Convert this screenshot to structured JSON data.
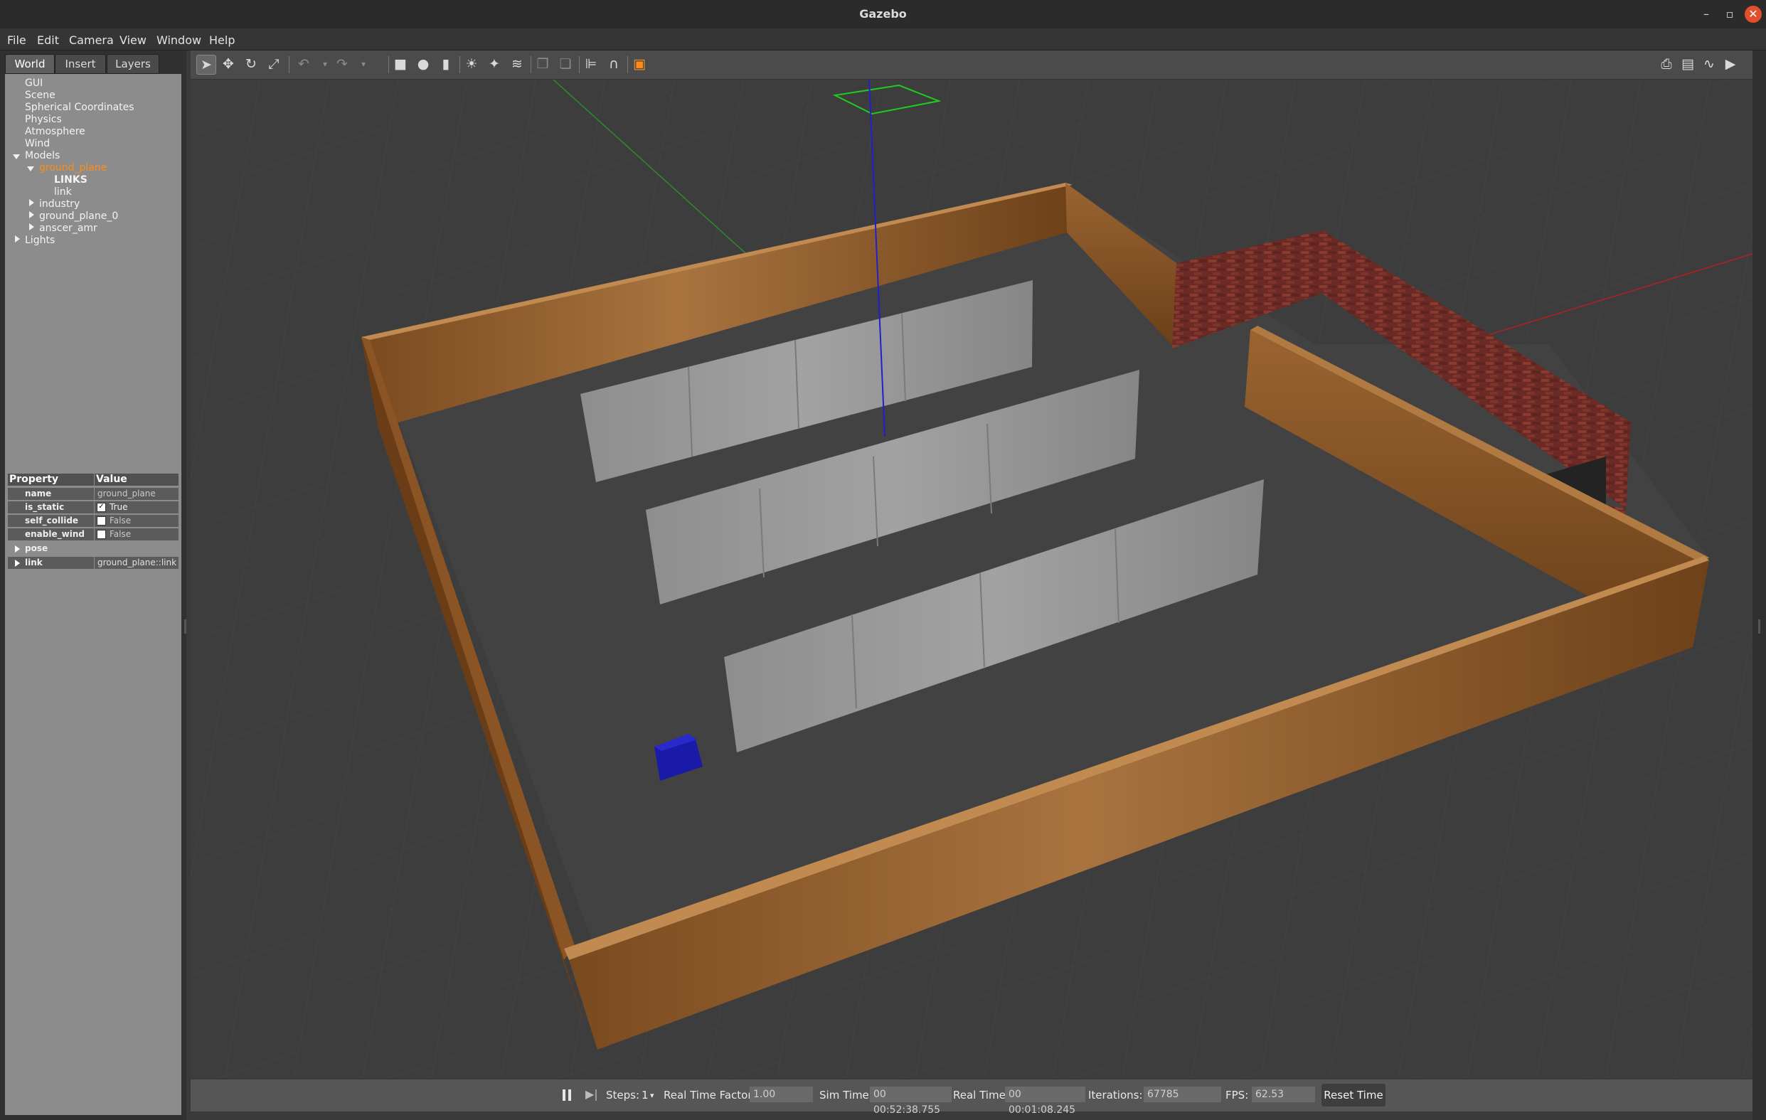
{
  "window": {
    "title": "Gazebo",
    "minimize": "–",
    "restore": "▫",
    "close": "✕"
  },
  "menu": [
    "File",
    "Edit",
    "Camera",
    "View",
    "Window",
    "Help"
  ],
  "tabs": [
    "World",
    "Insert",
    "Layers"
  ],
  "tree": {
    "gui": "GUI",
    "scene": "Scene",
    "spherical": "Spherical Coordinates",
    "physics": "Physics",
    "atmosphere": "Atmosphere",
    "wind": "Wind",
    "models": "Models",
    "ground_plane": "ground_plane",
    "links": "LINKS",
    "link": "link",
    "industry": "industry",
    "ground_plane_0": "ground_plane_0",
    "anscer_amr": "anscer_amr",
    "lights": "Lights"
  },
  "properties": {
    "header_property": "Property",
    "header_value": "Value",
    "name_label": "name",
    "name_value": "ground_plane",
    "is_static_label": "is_static",
    "is_static_value": "True",
    "is_static_check": "✓",
    "self_collide_label": "self_collide",
    "self_collide_value": "False",
    "enable_wind_label": "enable_wind",
    "enable_wind_value": "False",
    "pose_label": "pose",
    "link_label": "link",
    "link_value": "ground_plane::link"
  },
  "status": {
    "steps_label": "Steps:",
    "steps_value": "1",
    "rtf_label": "Real Time Factor:",
    "rtf_value": "1.00",
    "sim_time_label": "Sim Time:",
    "sim_time_value": "00 00:52:38.755",
    "real_time_label": "Real Time:",
    "real_time_value": "00 00:01:08.245",
    "iterations_label": "Iterations:",
    "iterations_value": "67785",
    "fps_label": "FPS:",
    "fps_value": "62.53",
    "reset_label": "Reset Time"
  },
  "colors": {
    "selection": "#ff8c1a",
    "wood_wall": "#8a5424",
    "brick_wall": "#6e2b26",
    "concrete_wall": "#8a8a8a",
    "robot": "#1a1aa8",
    "axis_x": "#b22222",
    "axis_y": "#2e8b2e",
    "axis_z": "#2020cc"
  }
}
